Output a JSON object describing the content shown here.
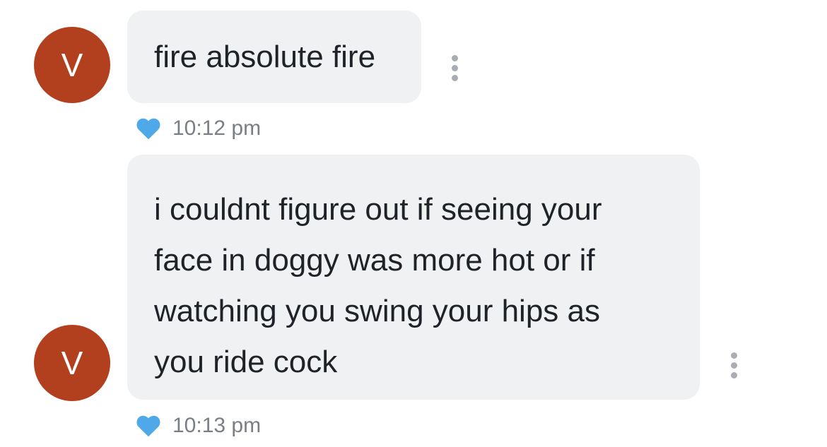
{
  "colors": {
    "avatar_bg": "#b2401f",
    "bubble_bg": "#f0f1f3",
    "heart": "#4fa8e8",
    "timestamp": "#7a7f86",
    "more_dots": "#a9adb3"
  },
  "messages": [
    {
      "avatar_initial": "V",
      "text": "fire absolute fire",
      "liked": true,
      "time": "10:12 pm"
    },
    {
      "avatar_initial": "V",
      "text": "i couldnt figure out if seeing your\nface in doggy was more hot or if\nwatching you swing your hips as\nyou ride cock",
      "liked": true,
      "time": "10:13 pm"
    }
  ],
  "icons": {
    "more": "more-vertical-icon",
    "like": "heart-icon"
  }
}
